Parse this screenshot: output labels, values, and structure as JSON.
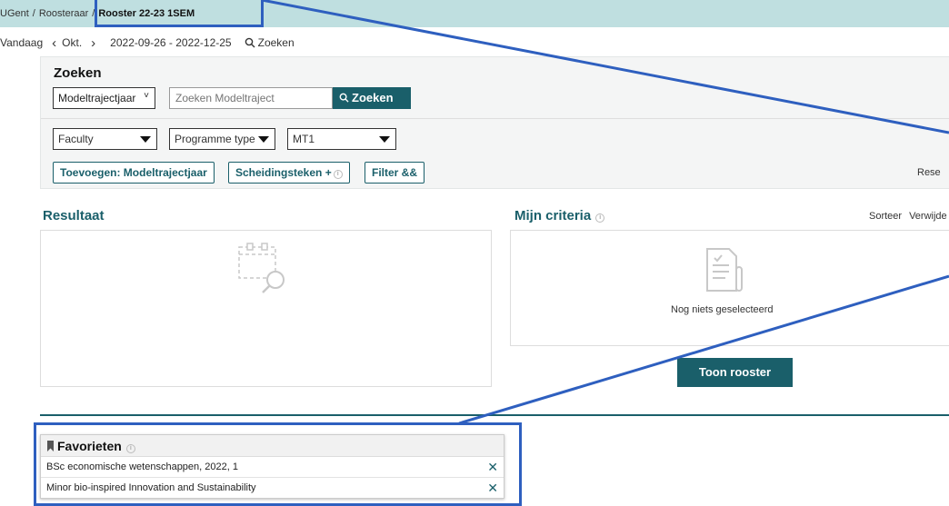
{
  "breadcrumb": {
    "items": [
      "UGent",
      "Roosteraar",
      "Rooster 22-23 1SEM"
    ],
    "separator": "/"
  },
  "nav": {
    "today": "Vandaag",
    "month": "Okt.",
    "date_range": "2022-09-26 - 2022-12-25",
    "search": "Zoeken"
  },
  "search_panel": {
    "title": "Zoeken",
    "type_select": "Modeltrajectjaar",
    "search_placeholder": "Zoeken Modeltraject",
    "search_button": "Zoeken",
    "filters": [
      "Faculty",
      "Programme type",
      "MT1"
    ],
    "actions": [
      "Toevoegen: Modeltrajectjaar",
      "Scheidingsteken +",
      "Filter &&"
    ],
    "reset": "Rese"
  },
  "result": {
    "title": "Resultaat"
  },
  "criteria": {
    "title": "Mijn criteria",
    "sort": "Sorteer",
    "remove": "Verwijde",
    "empty_text": "Nog niets geselecteerd",
    "show_button": "Toon rooster"
  },
  "favorites": {
    "title": "Favorieten",
    "items": [
      "BSc economische wetenschappen, 2022, 1",
      "Minor bio-inspired Innovation and Sustainability"
    ]
  },
  "colors": {
    "accent": "#1a5f6a",
    "topbar": "#bfdfe0",
    "highlight": "#2e5fbf"
  },
  "icons": [
    "search-icon",
    "calendar-search-icon",
    "document-icon",
    "bookmark-icon",
    "info-icon",
    "close-icon",
    "chevron-left-icon",
    "chevron-right-icon"
  ]
}
